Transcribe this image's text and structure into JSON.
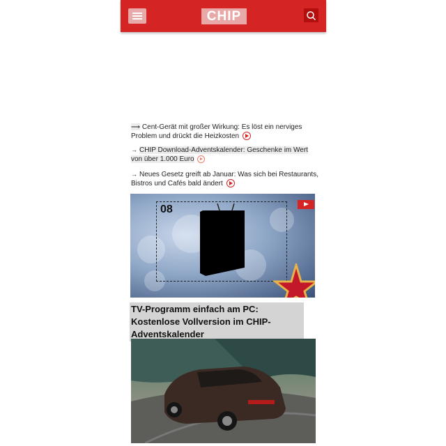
{
  "header": {
    "logo_text": "CHIP",
    "menu_icon": "hamburger-menu-icon",
    "search_icon": "search-icon",
    "brand_color": "#d42424"
  },
  "news_items": [
    {
      "text": "Cent-Gerät mit großer Wirkung: Es löst ein nerviges Problem und drückt die Heizkosten",
      "icon": "play-circle-icon"
    },
    {
      "text": "CHIP Download-Adventskalender: Geschenke im Wert von über 1.000 Euro",
      "icon": "play-circle-icon"
    },
    {
      "text": "Neues Gesetz greift ab Januar: Was sich bei Restaurants, Bistros und Cafés bald ändert",
      "icon": "play-circle-icon"
    }
  ],
  "video": {
    "day_number": "08",
    "play_icon": "youtube-play-icon"
  },
  "article": {
    "headline": "TV-Programm einfach am PC: Kostenlose Vollversion im CHIP-Adventskalender"
  }
}
